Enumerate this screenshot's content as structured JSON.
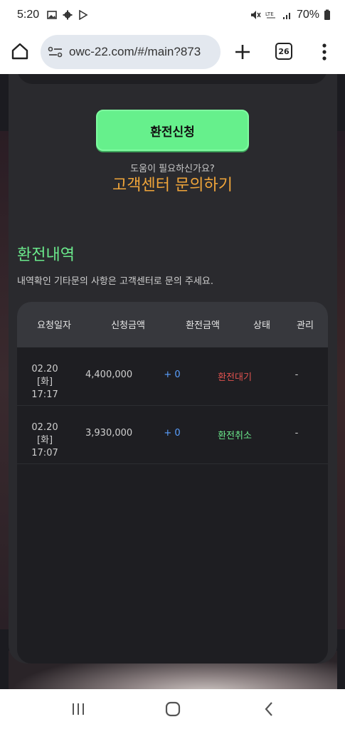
{
  "status_bar": {
    "time": "5:20",
    "battery": "70%"
  },
  "browser": {
    "url": "owc-22.com/#/main?873",
    "tab_count": "26"
  },
  "page": {
    "apply_button": "환전신청",
    "help_text": "도움이 필요하신가요?",
    "help_link": "고객센터 문의하기",
    "section_title": "환전내역",
    "section_desc": "내역확인 기타문의 사항은 고객센터로 문의 주세요.",
    "table": {
      "headers": [
        "요청일자",
        "신청금액",
        "환전금액",
        "상태",
        "관리"
      ],
      "rows": [
        {
          "date": "02.20 [화]",
          "time": "17:17",
          "request_amount": "4,400,000",
          "exchange_amount": "+ 0",
          "status": "환전대기",
          "manage": "-"
        },
        {
          "date": "02.20 [화]",
          "time": "17:07",
          "request_amount": "3,930,000",
          "exchange_amount": "+ 0",
          "status": "환전취소",
          "manage": "-"
        }
      ]
    }
  },
  "colors": {
    "accent_green": "#66f08c",
    "link_orange": "#f0a53a",
    "status_waiting": "#e0524f",
    "status_cancelled": "#6bea8c",
    "amount_blue": "#5aa0ff"
  }
}
